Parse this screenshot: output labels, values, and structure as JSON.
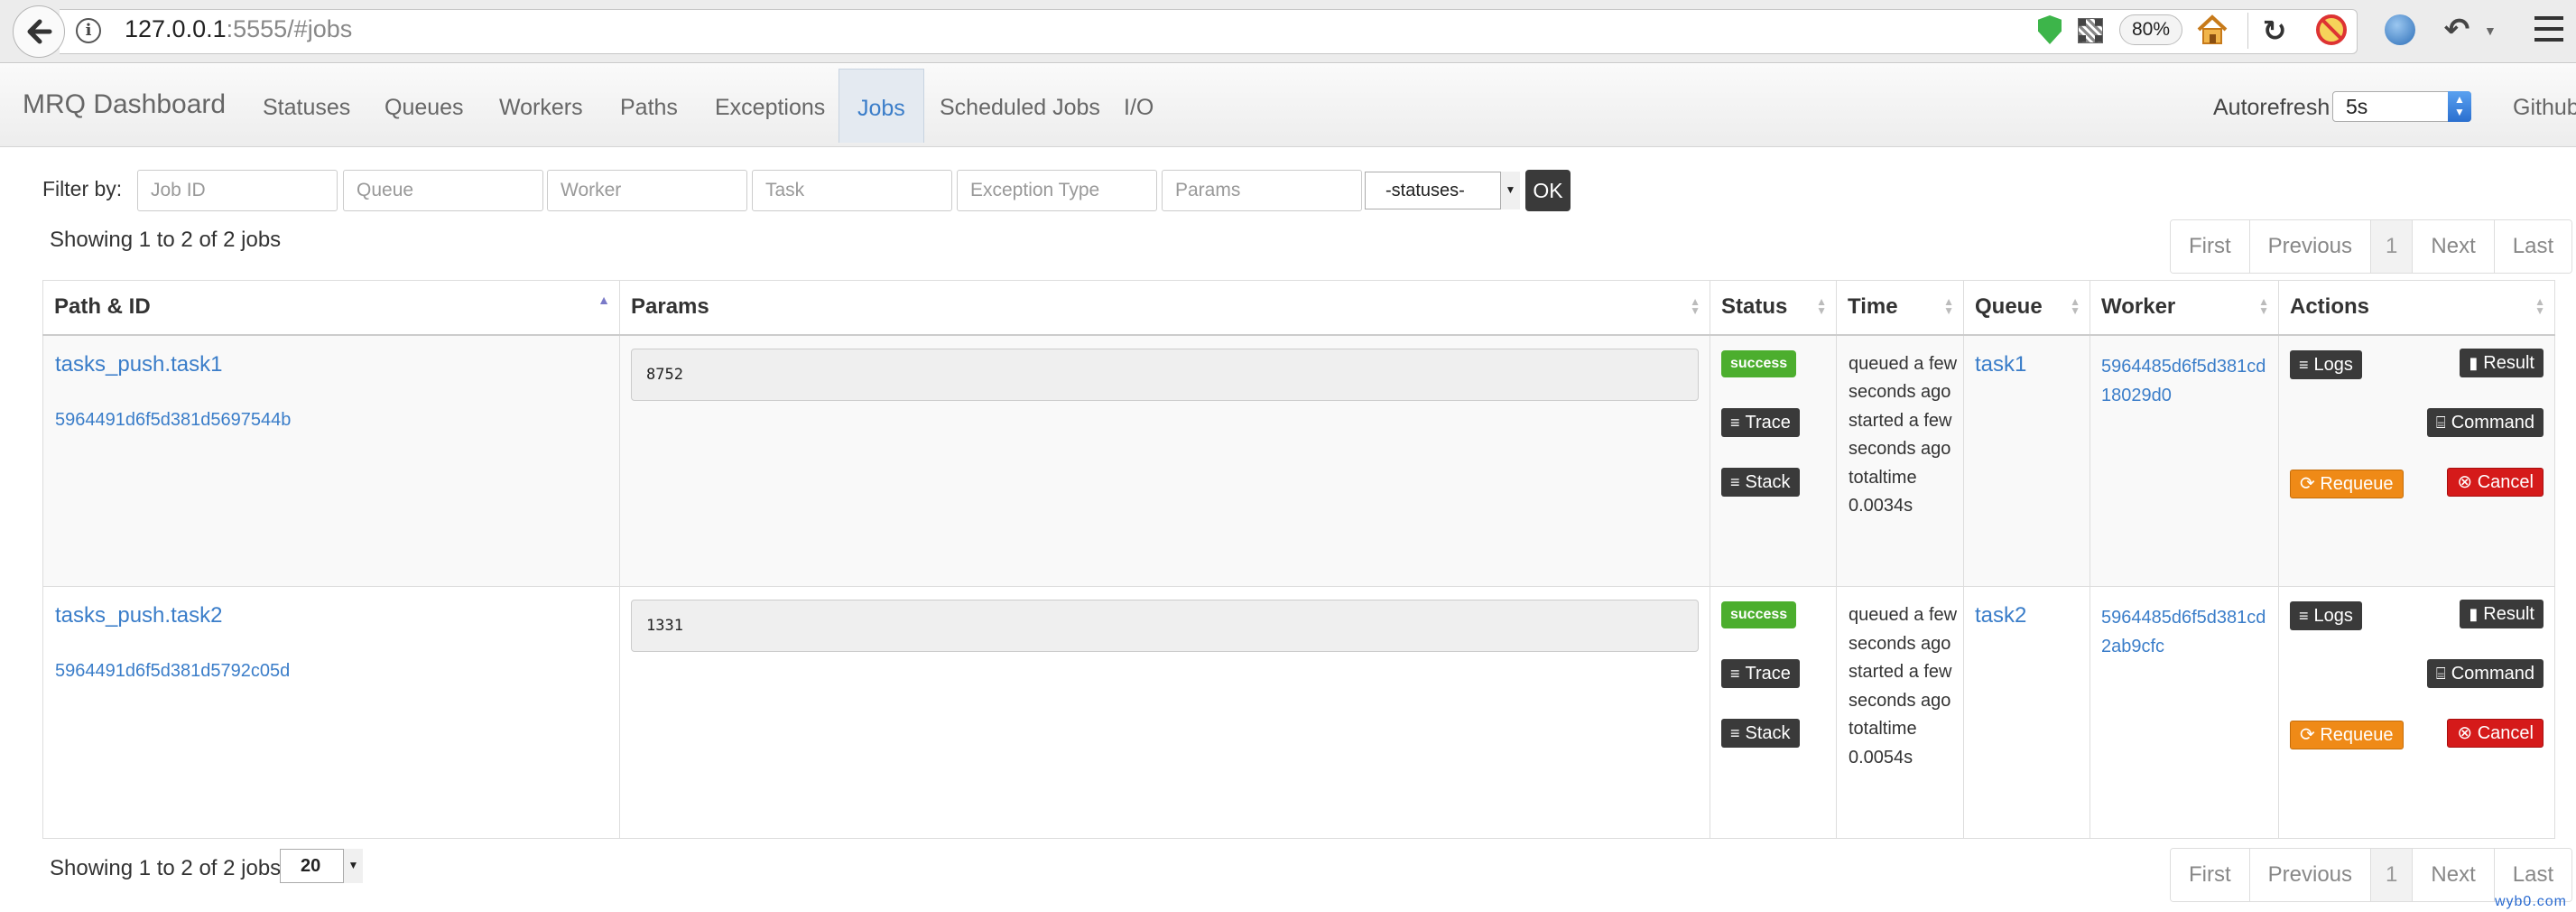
{
  "browser": {
    "url_host": "127.0.0.1",
    "url_rest": ":5555/#jobs",
    "zoom": "80%"
  },
  "navbar": {
    "brand": "MRQ Dashboard",
    "items": [
      {
        "label": "Statuses"
      },
      {
        "label": "Queues"
      },
      {
        "label": "Workers"
      },
      {
        "label": "Paths"
      },
      {
        "label": "Exceptions"
      },
      {
        "label": "Jobs"
      },
      {
        "label": "Scheduled Jobs"
      },
      {
        "label": "I/O"
      }
    ],
    "active": "Jobs",
    "autorefresh_label": "Autorefresh",
    "autorefresh_value": "5s",
    "github": "Github"
  },
  "filter": {
    "label": "Filter by:",
    "job_id_placeholder": "Job ID",
    "queue_placeholder": "Queue",
    "worker_placeholder": "Worker",
    "task_placeholder": "Task",
    "exception_placeholder": "Exception Type",
    "params_placeholder": "Params",
    "status_value": "-statuses-",
    "ok_label": "OK"
  },
  "summary": {
    "showing": "Showing 1 to 2 of 2 jobs",
    "per_page": "20"
  },
  "pagination": {
    "first": "First",
    "previous": "Previous",
    "current": "1",
    "next": "Next",
    "last": "Last"
  },
  "table": {
    "headers": {
      "path": "Path & ID",
      "params": "Params",
      "status": "Status",
      "time": "Time",
      "queue": "Queue",
      "worker": "Worker",
      "actions": "Actions"
    },
    "rows": [
      {
        "path": "tasks_push.task1",
        "id": "5964491d6f5d381d5697544b",
        "params": "8752",
        "status": "success",
        "time_queued": "queued a few seconds ago",
        "time_started": "started a few seconds ago",
        "time_total": "totaltime 0.0034s",
        "queue": "task1",
        "worker": "5964485d6f5d381cd18029d0"
      },
      {
        "path": "tasks_push.task2",
        "id": "5964491d6f5d381d5792c05d",
        "params": "1331",
        "status": "success",
        "time_queued": "queued a few seconds ago",
        "time_started": "started a few seconds ago",
        "time_total": "totaltime 0.0054s",
        "queue": "task2",
        "worker": "5964485d6f5d381cd2ab9cfc"
      }
    ]
  },
  "actions": {
    "trace": "Trace",
    "stack": "Stack",
    "logs": "Logs",
    "result": "Result",
    "command": "Command",
    "requeue": "Requeue",
    "cancel": "Cancel"
  },
  "watermark": "wyb0.com"
}
